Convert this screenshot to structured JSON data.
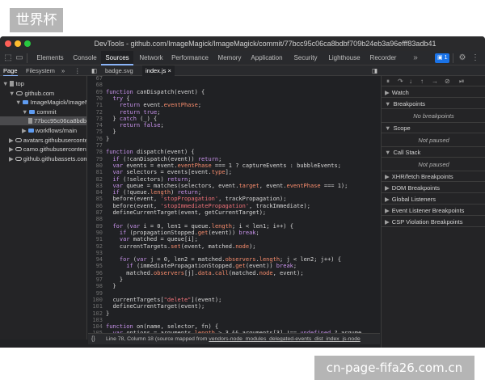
{
  "overlay": {
    "top_left_label": "世界杯",
    "bottom_right_label": "cn-page-fifa26.com.cn"
  },
  "window": {
    "title": "DevTools - github.com/ImageMagick/ImageMagick/commit/77bcc95c06ca8bdbf709b24eb3a96efff83adb41"
  },
  "toolbar": {
    "tabs": [
      "Elements",
      "Console",
      "Sources",
      "Network",
      "Performance",
      "Memory",
      "Application",
      "Security",
      "Lighthouse",
      "Recorder"
    ],
    "active_tab": "Sources",
    "more": "»",
    "issues_badge": "1"
  },
  "navigator": {
    "tabs": [
      "Page",
      "Filesystem"
    ],
    "more": "»",
    "tree": [
      {
        "label": "top",
        "indent": 0,
        "icon": "fileico",
        "arrow": "▼"
      },
      {
        "label": "github.com",
        "indent": 1,
        "icon": "cloud",
        "arrow": "▼"
      },
      {
        "label": "ImageMagick/ImageMagick",
        "indent": 2,
        "icon": "folder",
        "arrow": "▼"
      },
      {
        "label": "commit",
        "indent": 3,
        "icon": "folder",
        "arrow": "▼"
      },
      {
        "label": "77bcc95c06ca8bdbf709b24eb3a96efff83adb41",
        "indent": 4,
        "icon": "fileico",
        "arrow": ""
      },
      {
        "label": "workflows/main",
        "indent": 3,
        "icon": "folder",
        "arrow": "▶"
      },
      {
        "label": "avatars.githubusercontent.com",
        "indent": 1,
        "icon": "cloud",
        "arrow": "▶"
      },
      {
        "label": "camo.githubusercontent.com",
        "indent": 1,
        "icon": "cloud",
        "arrow": "▶"
      },
      {
        "label": "github.githubassets.com",
        "indent": 1,
        "icon": "cloud",
        "arrow": "▶"
      }
    ]
  },
  "editor": {
    "open_files": [
      "badge.svg",
      "index.js"
    ],
    "active_file": "index.js",
    "lines": [
      {
        "n": "67",
        "t": ""
      },
      {
        "n": "68",
        "t": ""
      },
      {
        "n": "69",
        "t": "function canDispatch(event) {"
      },
      {
        "n": "70",
        "t": "  try {"
      },
      {
        "n": "71",
        "t": "    return event.eventPhase;"
      },
      {
        "n": "72",
        "t": "    return true;"
      },
      {
        "n": "73",
        "t": "  } catch (_) {"
      },
      {
        "n": "74",
        "t": "    return false;"
      },
      {
        "n": "75",
        "t": "  }"
      },
      {
        "n": "76",
        "t": "}"
      },
      {
        "n": "77",
        "t": ""
      },
      {
        "n": "78",
        "t": "function dispatch(event) {"
      },
      {
        "n": "79",
        "t": "  if (!canDispatch(event)) return;"
      },
      {
        "n": "80",
        "t": "  var events = event.eventPhase === 1 ? captureEvents : bubbleEvents;"
      },
      {
        "n": "81",
        "t": "  var selectors = events[event.type];"
      },
      {
        "n": "82",
        "t": "  if (!selectors) return;"
      },
      {
        "n": "83",
        "t": "  var queue = matches(selectors, event.target, event.eventPhase === 1);"
      },
      {
        "n": "84",
        "t": "  if (!queue.length) return;"
      },
      {
        "n": "85",
        "t": "  before(event, 'stopPropagation', trackPropagation);"
      },
      {
        "n": "86",
        "t": "  before(event, 'stopImmediatePropagation', trackImmediate);"
      },
      {
        "n": "87",
        "t": "  defineCurrentTarget(event, getCurrentTarget);"
      },
      {
        "n": "88",
        "t": ""
      },
      {
        "n": "89",
        "t": "  for (var i = 0, len1 = queue.length; i < len1; i++) {"
      },
      {
        "n": "90",
        "t": "    if (propagationStopped.get(event)) break;"
      },
      {
        "n": "91",
        "t": "    var matched = queue[i];"
      },
      {
        "n": "92",
        "t": "    currentTargets.set(event, matched.node);"
      },
      {
        "n": "93",
        "t": ""
      },
      {
        "n": "94",
        "t": "    for (var j = 0, len2 = matched.observers.length; j < len2; j++) {"
      },
      {
        "n": "95",
        "t": "      if (immediatePropagationStopped.get(event)) break;"
      },
      {
        "n": "96",
        "t": "      matched.observers[j].data.call(matched.node, event);"
      },
      {
        "n": "97",
        "t": "    }"
      },
      {
        "n": "98",
        "t": "  }"
      },
      {
        "n": "99",
        "t": ""
      },
      {
        "n": "100",
        "t": "  currentTargets[\"delete\"](event);"
      },
      {
        "n": "101",
        "t": "  defineCurrentTarget(event);"
      },
      {
        "n": "102",
        "t": "}"
      },
      {
        "n": "103",
        "t": ""
      },
      {
        "n": "104",
        "t": "function on(name, selector, fn) {"
      },
      {
        "n": "105",
        "t": "  var options = arguments.length > 3 && arguments[3] !== undefined ? argume"
      },
      {
        "n": "106",
        "t": "  var capture = options.capture ? true : false;"
      }
    ]
  },
  "status": {
    "braces": "{}",
    "text": "Line 78, Column 18  (source mapped from ",
    "link": "vendors-node_modules_delegated-events_dist_index_js-node"
  },
  "debugger": {
    "sections": [
      {
        "label": "Watch",
        "body": ""
      },
      {
        "label": "Breakpoints",
        "body": "No breakpoints"
      },
      {
        "label": "Scope",
        "body": "Not paused"
      },
      {
        "label": "Call Stack",
        "body": "Not paused"
      },
      {
        "label": "XHR/fetch Breakpoints",
        "body": ""
      },
      {
        "label": "DOM Breakpoints",
        "body": ""
      },
      {
        "label": "Global Listeners",
        "body": ""
      },
      {
        "label": "Event Listener Breakpoints",
        "body": ""
      },
      {
        "label": "CSP Violation Breakpoints",
        "body": ""
      }
    ]
  }
}
